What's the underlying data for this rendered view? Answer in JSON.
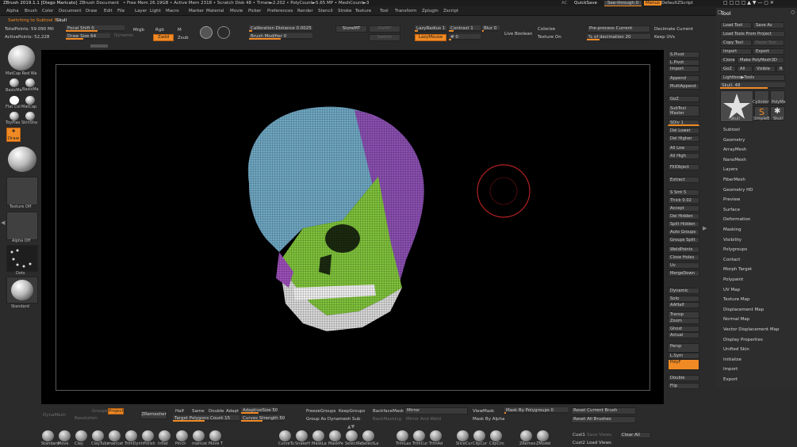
{
  "titlebar": {
    "app": "ZBrush 2019.1.1 [Diego Maricato]",
    "doc": "ZBrush Document",
    "stats": "• Free Mem 26.19GB • Active Mem 2318 • Scratch Disk 48 • Timer►2.202 • PolyCount►5.65 MP • MeshCount►3",
    "ac": "AC",
    "quicksave": "QuickSave",
    "seethrough": "See-through  0",
    "menus_btn": "Menus",
    "script": "DefaultZScript"
  },
  "menubar": [
    "Alpha",
    "Brush",
    "Color",
    "Document",
    "Draw",
    "Edit",
    "File",
    "Layer",
    "Light",
    "Macro",
    "Marker",
    "Material",
    "Movie",
    "Picker",
    "Preferences",
    "Render",
    "Stencil",
    "Stroke",
    "Texture",
    "Tool",
    "Transform",
    "Zplugin",
    "Zscript"
  ],
  "status": {
    "switching": "Switching to Subtool 5:",
    "subtool": "Skull",
    "total_points": "TotalPoints: 59.090 Mil",
    "active_points": "ActivePoints: 52,228"
  },
  "topshelf": {
    "focal_shift": "Focal Shift 0",
    "draw_size": "Draw Size 64",
    "dynamic": "Dynamic",
    "mrgb": "Mrgb",
    "rgb": "Rgb",
    "m": "M",
    "zadd": "Zadd",
    "zsub": "Zsub",
    "calibration": "Calibration Distance 0.0025",
    "brush_modifier": "Brush Modifier 0",
    "storemt": "StoreMT",
    "delmt": "DelMT",
    "switch": "Switch",
    "lazyradius": "LazyRadius 1",
    "contrast": "Contrast 1",
    "blur": "Blur 0",
    "lazymouse": "LazyMouse",
    "lazy_step": "# 0",
    "live_boolean": "Live Boolean",
    "colorize": "Colorize",
    "texture_on": "Texture On",
    "preprocess": "Pre-process Current",
    "pct_decimation": "% of decimation 20",
    "decimate": "Decimate Current",
    "keep_uvs": "Keep UVs"
  },
  "leftshelf": {
    "material": "MatCap Red Wa",
    "mat2": "BasicMa",
    "mat3": "BasicMa",
    "mat4": "Flat Col",
    "mat5": "MatCap",
    "mat6": "ToyPlas",
    "mat7": "SkinSha",
    "draw": "Draw",
    "texture": "Texture Off",
    "alpha": "Alpha Off",
    "dots": "Dots",
    "standard": "Standard"
  },
  "rightshelf": [
    "S.Pivot",
    "L.Pivot",
    "Import",
    "Append",
    "MultiAppend",
    "GoZ",
    "SubTool Master",
    "SDiv 1",
    "Del Lower",
    "Del Higher",
    "All Low",
    "All High",
    "FillObject",
    "Extract",
    "S Smt 5",
    "Thick 0.02",
    "Accept",
    "Del Hidden",
    "Split Hidden",
    "Auto Groups",
    "Groups Split",
    "WeldPoints",
    "Close Holes",
    "Uv",
    "MergeDown",
    "Dynamic",
    "Solo",
    "AAHalf",
    "Transp",
    "Zoom",
    "Ghost",
    "Actual",
    "Persp",
    "L.Sym",
    "PolyF",
    "Double",
    "Flip"
  ],
  "toolpanel": {
    "title": "Tool",
    "load_tool": "Load Tool",
    "save_as": "Save As",
    "load_project": "Load Tools From Project",
    "copy_tool": "Copy Tool",
    "paste_tool": "Paste Tool",
    "import": "Import",
    "export": "Export",
    "clone": "Clone",
    "make_polymesh": "Make PolyMesh3D",
    "goz": "GoZ",
    "all": "All",
    "visible": "Visible",
    "r": "R",
    "lightbox": "Lightbox▶Tools",
    "skull_slider": "Skull. 48",
    "t1": "Skull",
    "t2": "Cylinder",
    "t3": "PolyMe",
    "t4": "SimpleB",
    "t5": "Skull",
    "sections": [
      "Subtool",
      "Geometry",
      "ArrayMesh",
      "NanoMesh",
      "Layers",
      "FiberMesh",
      "Geometry HD",
      "Preview",
      "Surface",
      "Deformation",
      "Masking",
      "Visibility",
      "Polygroups",
      "Contact",
      "Morph Target",
      "Polypaint",
      "UV Map",
      "Texture Map",
      "Displacement Map",
      "Normal Map",
      "Vector Displacement Map",
      "Display Properties",
      "Unified Skin",
      "Initialize",
      "Import",
      "Export"
    ]
  },
  "bottom1": {
    "dynamesh": "DynaMesh",
    "groups": "Groups",
    "project": "Project",
    "resolution": "Resolution",
    "zremesher": "ZRemesher",
    "half": "Half",
    "same": "Same",
    "double": "Double",
    "adapt": "Adapt",
    "adaptive_size": "AdaptiveSize 50",
    "target_poly": "Target Polygons Count 15",
    "curves_strength": "Curves Strength 50",
    "freeze_groups": "FreezeGroups",
    "keep_groups": "KeepGroups",
    "group_dynamesh": "Group As Dynamesh Sub",
    "backface": "BackfaceMask",
    "backmasking": "BackMasking",
    "mirror": "Mirror",
    "mirror_weld": "Mirror And Weld",
    "viewmask": "ViewMask",
    "mask_polygroups": "Mask By Polygroups 0",
    "mask_alpha": "Mask By Alpha",
    "reset_brush": "Reset Current Brush",
    "reset_all": "Reset All Brushes"
  },
  "brushes": [
    "Standard",
    "Move",
    "Clay",
    "ClayTubs",
    "maricat",
    "TrimDyn",
    "hPolish",
    "Inflat",
    "Pinch",
    "maricat",
    "Move T",
    "CurveTu",
    "SnakeH",
    "MaskLa",
    "MaskPe",
    "SelectRe",
    "SelectLa",
    "TrimLas",
    "TrimCur",
    "TrimAd",
    "SliceCur",
    "ClipCur",
    "ClipCirc",
    "ZRemes",
    "ZModel"
  ],
  "bottom2": {
    "cust1": "Cust1",
    "cust2": "Cust2",
    "save_views": "Save Views",
    "load_views": "Load Views",
    "clear_all": "Clear All"
  },
  "colors": {
    "accent": "#f08a24",
    "bg": "#2b2b2b",
    "viewport": "#000000",
    "cursor_ring": "#b02020"
  }
}
